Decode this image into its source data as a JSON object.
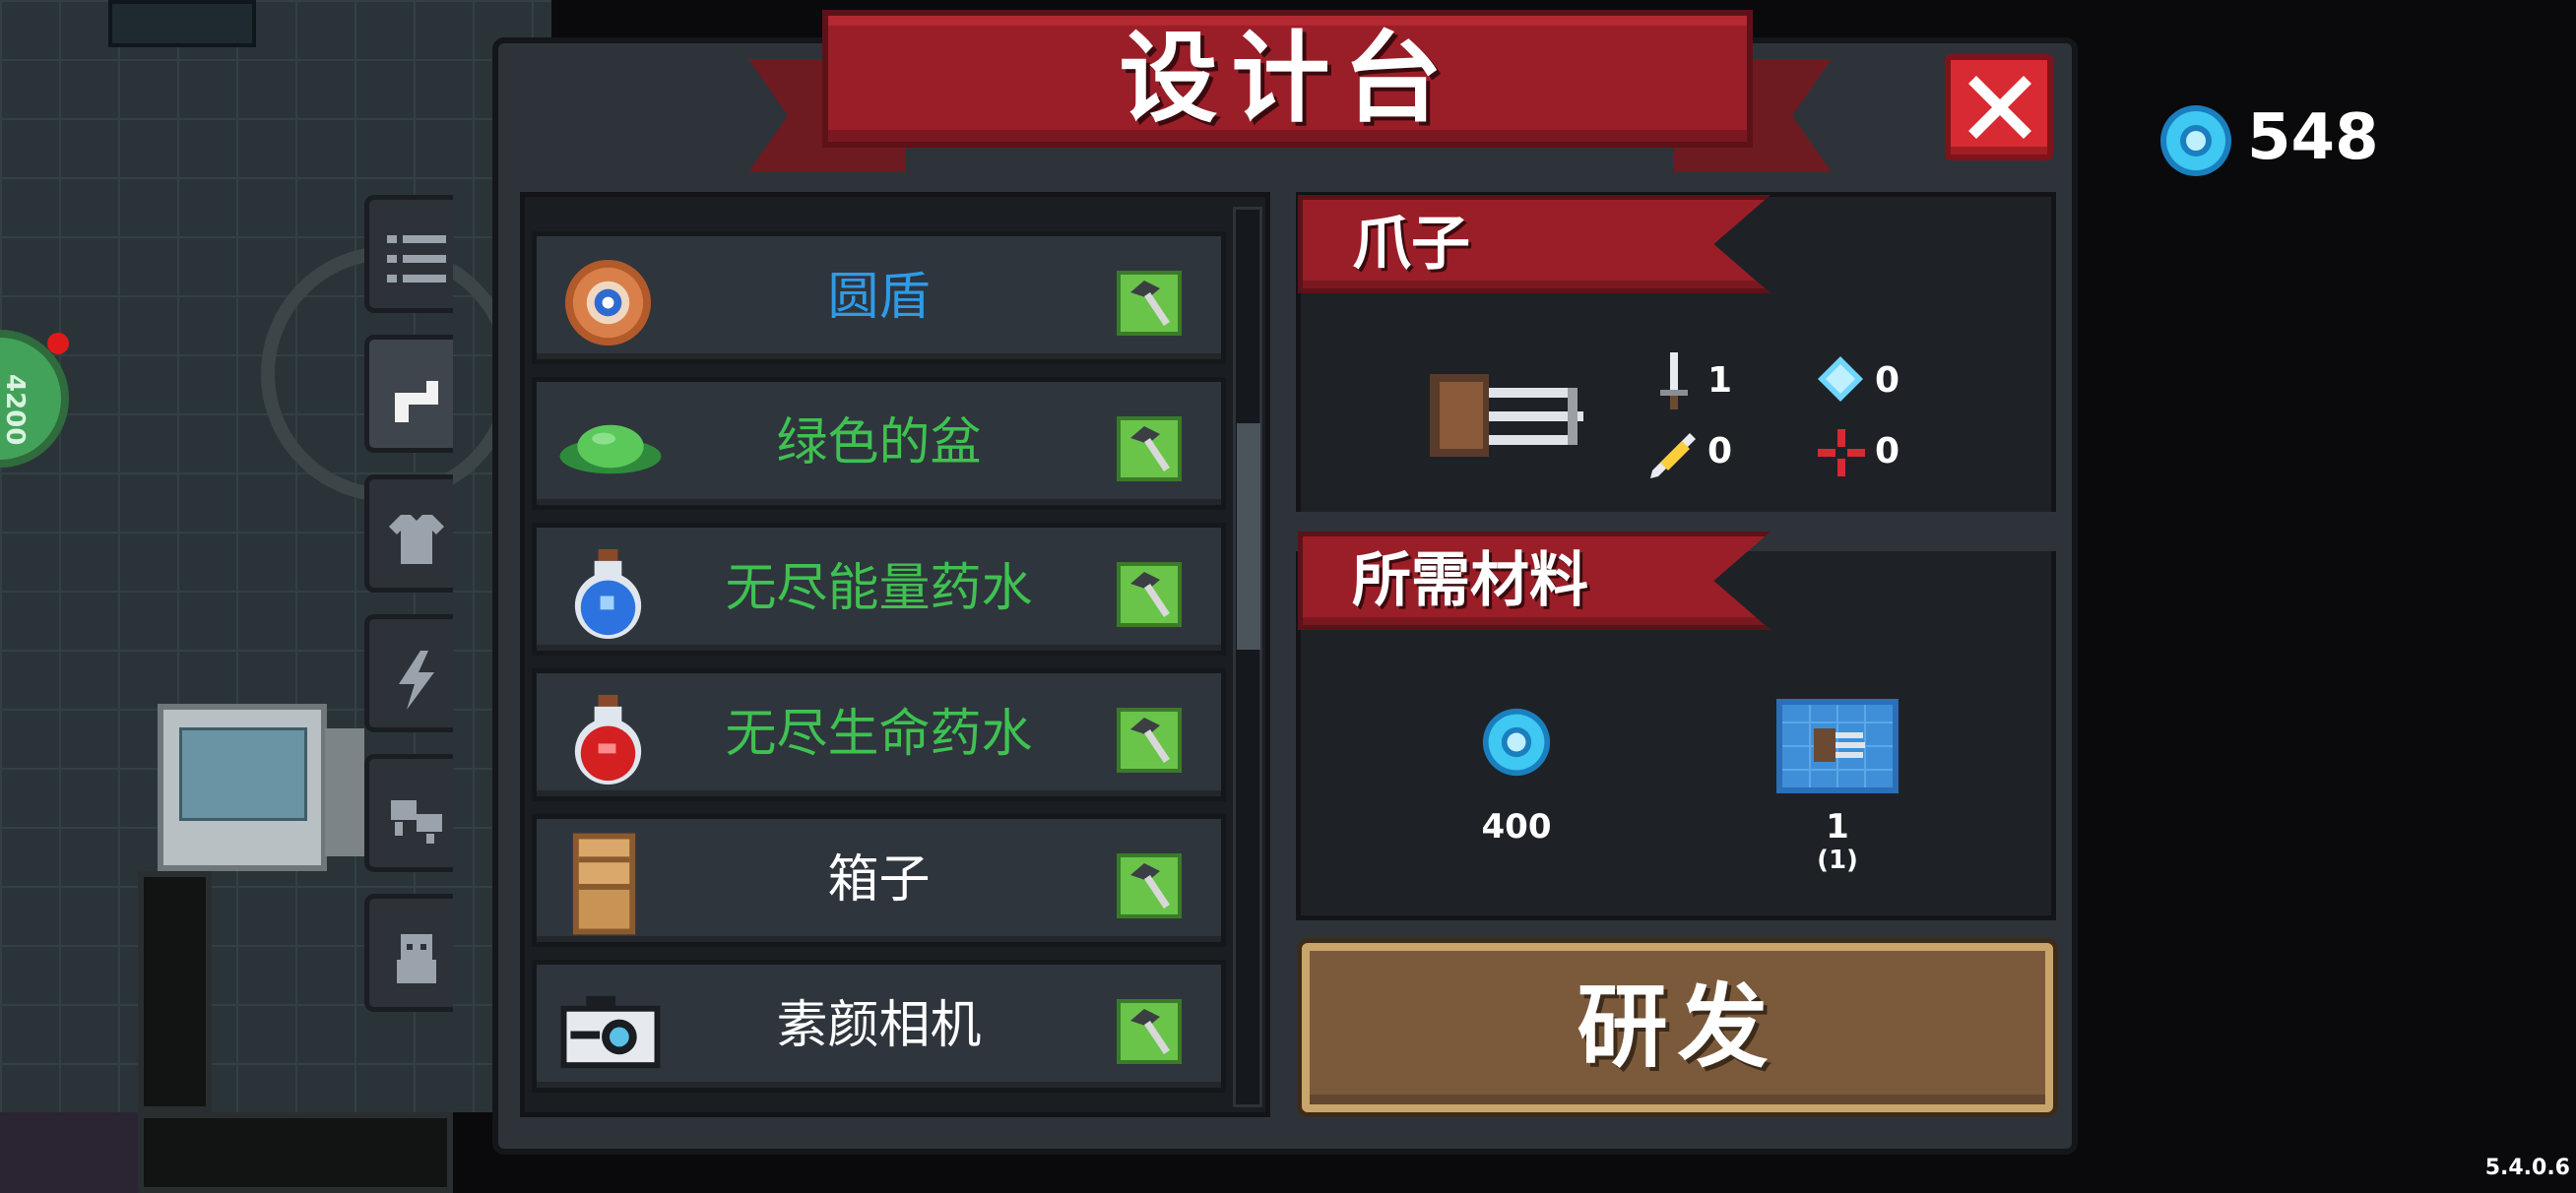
{
  "title": "设计台",
  "currency": {
    "count": "548",
    "icon": "gem-icon",
    "color": "#3ec8f2"
  },
  "background": {
    "badge_number": "4200"
  },
  "tabs": [
    {
      "name": "list",
      "icon": "list-icon",
      "active": false
    },
    {
      "name": "weapons",
      "icon": "gun-icon",
      "active": true
    },
    {
      "name": "armor",
      "icon": "shirt-icon",
      "active": false
    },
    {
      "name": "skills",
      "icon": "lightning-icon",
      "active": false
    },
    {
      "name": "pets",
      "icon": "pet-icon",
      "active": false
    },
    {
      "name": "characters",
      "icon": "character-icon",
      "active": false
    }
  ],
  "items": [
    {
      "label": "圆盾",
      "color": "#2e9be8",
      "icon": "round-shield-icon"
    },
    {
      "label": "绿色的盆",
      "color": "#3fc152",
      "icon": "green-basin-icon"
    },
    {
      "label": "无尽能量药水",
      "color": "#3fc152",
      "icon": "blue-potion-icon"
    },
    {
      "label": "无尽生命药水",
      "color": "#3fc152",
      "icon": "red-potion-icon"
    },
    {
      "label": "箱子",
      "color": "#ffffff",
      "icon": "crate-icon"
    },
    {
      "label": "素颜相机",
      "color": "#ffffff",
      "icon": "camera-icon"
    }
  ],
  "detail": {
    "name": "爪子",
    "stats": {
      "damage": "1",
      "energy": "0",
      "crit": "0",
      "accuracy": "0"
    }
  },
  "materials": {
    "heading": "所需材料",
    "gem_cost": "400",
    "blueprint_qty": "1",
    "blueprint_owned": "(1)"
  },
  "research_button": "研发",
  "version": "5.4.0.6"
}
